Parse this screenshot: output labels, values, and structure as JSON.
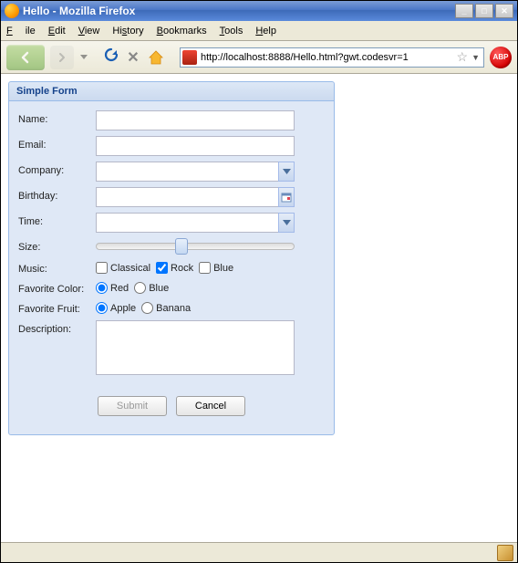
{
  "window": {
    "title": "Hello - Mozilla Firefox"
  },
  "menu": {
    "file": "File",
    "edit": "Edit",
    "view": "View",
    "history": "History",
    "bookmarks": "Bookmarks",
    "tools": "Tools",
    "help": "Help"
  },
  "url": "http://localhost:8888/Hello.html?gwt.codesvr=1",
  "abp_label": "ABP",
  "form": {
    "title": "Simple Form",
    "labels": {
      "name": "Name:",
      "email": "Email:",
      "company": "Company:",
      "birthday": "Birthday:",
      "time": "Time:",
      "size": "Size:",
      "music": "Music:",
      "fav_color": "Favorite Color:",
      "fav_fruit": "Favorite Fruit:",
      "description": "Description:"
    },
    "values": {
      "name": "",
      "email": "",
      "company": "",
      "birthday": "",
      "time": "",
      "description": ""
    },
    "music": {
      "classical": {
        "label": "Classical",
        "checked": false
      },
      "rock": {
        "label": "Rock",
        "checked": true
      },
      "blue": {
        "label": "Blue",
        "checked": false
      }
    },
    "color": {
      "red": {
        "label": "Red",
        "checked": true
      },
      "blue": {
        "label": "Blue",
        "checked": false
      }
    },
    "fruit": {
      "apple": {
        "label": "Apple",
        "checked": true
      },
      "banana": {
        "label": "Banana",
        "checked": false
      }
    },
    "buttons": {
      "submit": "Submit",
      "cancel": "Cancel"
    }
  }
}
